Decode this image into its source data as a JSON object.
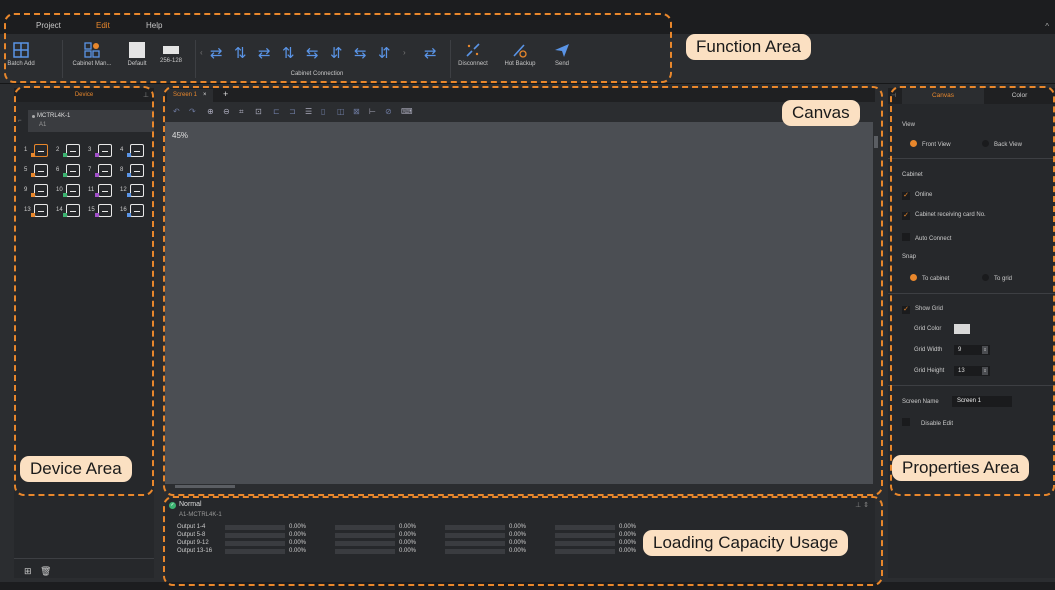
{
  "menu": {
    "items": [
      "Project",
      "Edit",
      "Help"
    ],
    "active": "Edit"
  },
  "ribbon": {
    "buttons": [
      {
        "label": "Batch Add",
        "icon": "batch-add-icon"
      },
      {
        "label": "Cabinet Man...",
        "icon": "cabinet-manager-icon"
      },
      {
        "label": "Default",
        "icon": "default-cabinet-icon"
      },
      {
        "label": "256-128",
        "icon": "cabinet-256-128-icon"
      }
    ],
    "cabinet_connection_label": "Cabinet Connection",
    "right_buttons": [
      {
        "label": "Disconnect",
        "icon": "disconnect-icon"
      },
      {
        "label": "Hot Backup",
        "icon": "hot-backup-icon"
      },
      {
        "label": "Send",
        "icon": "send-icon"
      }
    ]
  },
  "annotations": {
    "function_area": "Function Area",
    "canvas": "Canvas",
    "device_area": "Device Area",
    "properties_area": "Properties Area",
    "loading_capacity": "Loading Capacity Usage"
  },
  "device": {
    "tab": "Device",
    "controller": "MCTRL4K-1",
    "controller_sub": "A1",
    "ports": [
      "1",
      "2",
      "3",
      "4",
      "5",
      "6",
      "7",
      "8",
      "9",
      "10",
      "11",
      "12",
      "13",
      "14",
      "15",
      "16"
    ]
  },
  "canvas": {
    "tab": "Screen 1",
    "tab_close": "×",
    "add": "+",
    "zoom": "45%"
  },
  "loading": {
    "status": "Normal",
    "controller": "A1-MCTRL4K-1",
    "rows": [
      {
        "name": "Output 1-4",
        "values": [
          "0.00%",
          "0.00%",
          "0.00%",
          "0.00%"
        ]
      },
      {
        "name": "Output 5-8",
        "values": [
          "0.00%",
          "0.00%",
          "0.00%",
          "0.00%"
        ]
      },
      {
        "name": "Output 9-12",
        "values": [
          "0.00%",
          "0.00%",
          "0.00%",
          "0.00%"
        ]
      },
      {
        "name": "Output 13-16",
        "values": [
          "0.00%",
          "0.00%",
          "0.00%",
          "0.00%"
        ]
      }
    ]
  },
  "properties": {
    "tabs": [
      "Canvas",
      "Color"
    ],
    "active_tab": "Canvas",
    "view_label": "View",
    "front_view": "Front View",
    "back_view": "Back View",
    "cabinet_label": "Cabinet",
    "online": "Online",
    "receiving_card_no": "Cabinet receiving card No.",
    "auto_connect": "Auto Connect",
    "snap_label": "Snap",
    "to_cabinet": "To cabinet",
    "to_grid": "To grid",
    "show_grid": "Show Grid",
    "grid_color": "Grid Color",
    "grid_width": "Grid Width",
    "grid_width_value": "9",
    "grid_height": "Grid Height",
    "grid_height_value": "13",
    "screen_name": "Screen Name",
    "screen_name_value": "Screen 1",
    "disable_edit": "Disable Edit"
  }
}
